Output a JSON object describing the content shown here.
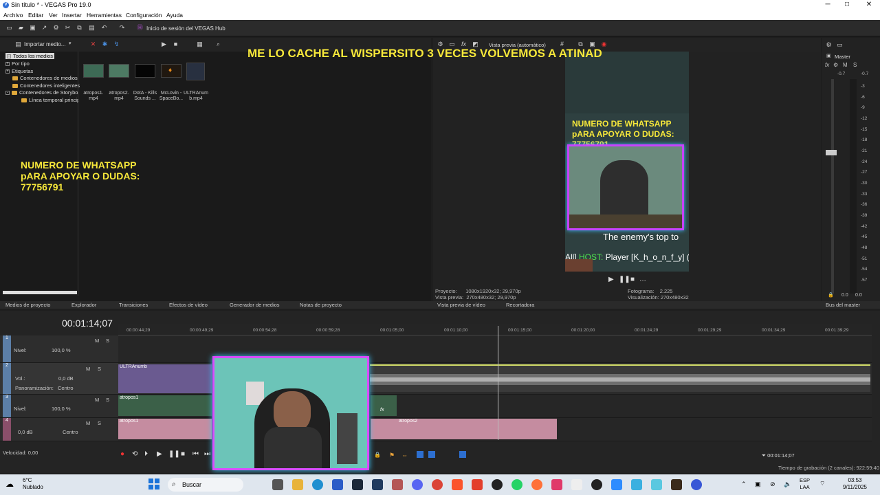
{
  "window": {
    "title": "Sin título * - VEGAS Pro 19.0",
    "minimize": "─",
    "maximize": "□",
    "close": "✕"
  },
  "menu": [
    "Archivo",
    "Editar",
    "Ver",
    "Insertar",
    "Herramientas",
    "Configuración",
    "Ayuda"
  ],
  "toolbar": {
    "hub_label": "Inicio de sesión del VEGAS Hub"
  },
  "media": {
    "import_label": "Importar medio...",
    "tree": [
      "Todos los medios",
      "Por tipo",
      "Etiquetas",
      "Contenedores de medios",
      "Contenedores inteligentes",
      "Contenedores de Storyboard",
      "Línea temporal principal"
    ],
    "files": [
      {
        "name": "atropos1.",
        "name2": "mp4"
      },
      {
        "name": "atropos2.",
        "name2": "mp4"
      },
      {
        "name": "DotA - Kills",
        "name2": "Sounds ..."
      },
      {
        "name": "McLovin -",
        "name2": "SpaceBo..."
      },
      {
        "name": "ULTRAnum",
        "name2": "b.mp4"
      }
    ]
  },
  "overlay": {
    "top_text": "ME LO CACHE AL WISPERSITO 3 VECES VOLVEMOS A ATINAD",
    "left_line1": "NUMERO DE WHATSAPP",
    "left_line2": "pARA APOYAR O DUDAS:",
    "left_line3": "77756791"
  },
  "preview": {
    "mode": "Vista previa (automático)",
    "wa_line1": "NUMERO DE WHATSAPP",
    "wa_line2": "pARA APOYAR O DUDAS:",
    "wa_line3": "77756791",
    "caption1": "The enemy's top to",
    "caption2_pre": "All] ",
    "caption2_host": "HOST:",
    "caption2_post": " Player [K_h_o_n_f_y] (",
    "proyecto_label": "Proyecto:",
    "proyecto_val": "1080x1920x32; 29,970p",
    "vista_label": "Vista previa:",
    "vista_val": "270x480x32; 29,970p",
    "fotograma_label": "Fotograma:",
    "fotograma_val": "2.225",
    "visualizacion_label": "Visualización:",
    "visualizacion_val": "270x480x32"
  },
  "master": {
    "label": "Master",
    "ticks": [
      "-0.7",
      "-0.7",
      "-3",
      "-6",
      "-9",
      "-12",
      "-15",
      "-18",
      "-21",
      "-24",
      "-27",
      "-30",
      "-33",
      "-36",
      "-39",
      "-42",
      "-45",
      "-48",
      "-51",
      "-54",
      "-57"
    ],
    "bottom_left": "0.0",
    "bottom_right": "0.0"
  },
  "tabs": [
    "Medios de proyecto",
    "Explorador",
    "Transiciones",
    "Efectos de vídeo",
    "Generador de medios",
    "Notas de proyecto",
    "Vista previa de vídeo",
    "Recortadora",
    "Bus del master"
  ],
  "timeline": {
    "time": "00:01:14;07",
    "ruler": [
      "00:00:44;29",
      "00:00:49;29",
      "00:00:54;28",
      "00:00:59;28",
      "00:01:05;00",
      "00:01:10;00",
      "00:01:15;00",
      "00:01:20;00",
      "00:01:24;29",
      "00:01:29;29",
      "00:01:34;29",
      "00:01:39;29"
    ],
    "tracks": [
      {
        "num": "1",
        "label": "Nivel:",
        "value": "100,0 %"
      },
      {
        "num": "2",
        "label": "Vol.:",
        "value": "0,0 dB",
        "pan_label": "Panoramización:",
        "pan_value": "Centro"
      },
      {
        "num": "3",
        "label": "Nivel:",
        "value": "100,0 %"
      },
      {
        "num": "4",
        "label": "0,0 dB",
        "value": "Centro"
      }
    ],
    "clips": {
      "ultra": "ULTRAnumb",
      "atropos1": "atropos1",
      "atropos1b": "atropos1",
      "atropos2": "atropos2",
      "fx": "fx"
    },
    "speed": "Velocidad: 0,00",
    "time_right": "00:01:14;07",
    "rec": "Tiempo de grabación (2 canales): 922:59:40",
    "m": "M",
    "s": "S"
  },
  "taskbar": {
    "temp": "6°C",
    "weather": "Nublado",
    "search": "Buscar",
    "lang1": "ESP",
    "lang2": "LAA",
    "time": "03:53",
    "date": "9/11/2025"
  },
  "colors": {
    "overlay_yellow": "#f7e83a",
    "clip_purple": "#7b5fa8",
    "clip_pink": "#d58ca0",
    "track_blue": "#5c7fa8"
  }
}
